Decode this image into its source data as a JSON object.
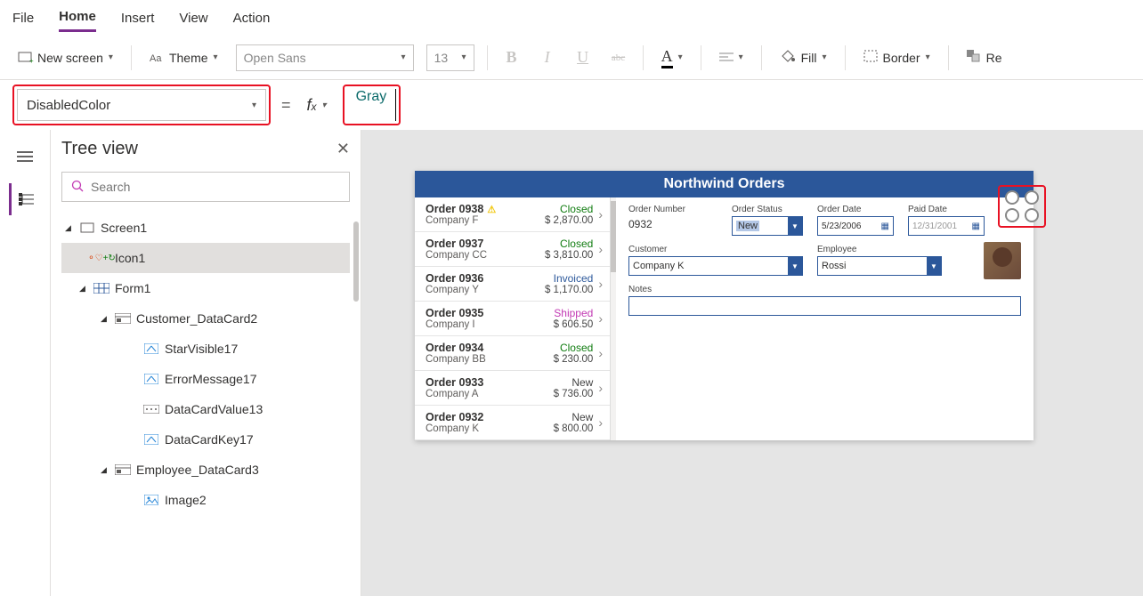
{
  "menubar": [
    "File",
    "Home",
    "Insert",
    "View",
    "Action"
  ],
  "ribbon": {
    "newscreen": "New screen",
    "theme": "Theme",
    "font": "Open Sans",
    "size": "13",
    "fill": "Fill",
    "border": "Border",
    "reorder": "Re"
  },
  "formula": {
    "property": "DisabledColor",
    "value": "Gray"
  },
  "tree": {
    "title": "Tree view",
    "search_ph": "Search",
    "nodes": {
      "screen1": "Screen1",
      "icon1": "Icon1",
      "form1": "Form1",
      "customer_dc": "Customer_DataCard2",
      "starvisible": "StarVisible17",
      "errormsg": "ErrorMessage17",
      "dcvalue": "DataCardValue13",
      "dckey": "DataCardKey17",
      "employee_dc": "Employee_DataCard3",
      "image2": "Image2"
    }
  },
  "app": {
    "title": "Northwind Orders",
    "orders": [
      {
        "num": "Order 0938",
        "warn": true,
        "company": "Company F",
        "status": "Closed",
        "status_cls": "closed",
        "amount": "$ 2,870.00"
      },
      {
        "num": "Order 0937",
        "warn": false,
        "company": "Company CC",
        "status": "Closed",
        "status_cls": "closed",
        "amount": "$ 3,810.00"
      },
      {
        "num": "Order 0936",
        "warn": false,
        "company": "Company Y",
        "status": "Invoiced",
        "status_cls": "invoiced",
        "amount": "$ 1,170.00"
      },
      {
        "num": "Order 0935",
        "warn": false,
        "company": "Company I",
        "status": "Shipped",
        "status_cls": "shipped",
        "amount": "$ 606.50"
      },
      {
        "num": "Order 0934",
        "warn": false,
        "company": "Company BB",
        "status": "Closed",
        "status_cls": "closed",
        "amount": "$ 230.00"
      },
      {
        "num": "Order 0933",
        "warn": false,
        "company": "Company A",
        "status": "New",
        "status_cls": "new",
        "amount": "$ 736.00"
      },
      {
        "num": "Order 0932",
        "warn": false,
        "company": "Company K",
        "status": "New",
        "status_cls": "new",
        "amount": "$ 800.00"
      }
    ],
    "detail": {
      "order_number_lbl": "Order Number",
      "order_number": "0932",
      "order_status_lbl": "Order Status",
      "order_status": "New",
      "order_date_lbl": "Order Date",
      "order_date": "5/23/2006",
      "paid_date_lbl": "Paid Date",
      "paid_date": "12/31/2001",
      "customer_lbl": "Customer",
      "customer": "Company K",
      "employee_lbl": "Employee",
      "employee": "Rossi",
      "notes_lbl": "Notes"
    }
  }
}
